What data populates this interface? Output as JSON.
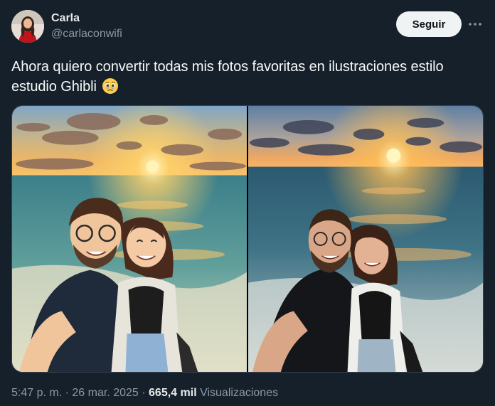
{
  "author": {
    "name": "Carla",
    "handle": "@carlaconwifi",
    "avatar_icon": "profile-photo"
  },
  "actions": {
    "follow_label": "Seguir",
    "more_icon": "more-horizontal-icon"
  },
  "tweet": {
    "text": "Ahora quiero convertir todas mis fotos favoritas en ilustraciones estilo estudio Ghibli",
    "emoji_icon": "holding-back-tears-emoji"
  },
  "media": [
    {
      "kind": "illustration",
      "subject": "Ghibli-style illustration of couple selfie at beach sunset"
    },
    {
      "kind": "photo",
      "subject": "Original selfie photo of couple at beach sunset"
    }
  ],
  "meta": {
    "time": "5:47 p. m.",
    "sep1": "·",
    "date": "26 mar. 2025",
    "sep2": "·",
    "views_count": "665,4 mil",
    "views_label": "Visualizaciones"
  },
  "colors": {
    "background": "#15202b",
    "follow_bg": "#eff3f4",
    "secondary_text": "#8b98a5",
    "border": "#38444d"
  }
}
